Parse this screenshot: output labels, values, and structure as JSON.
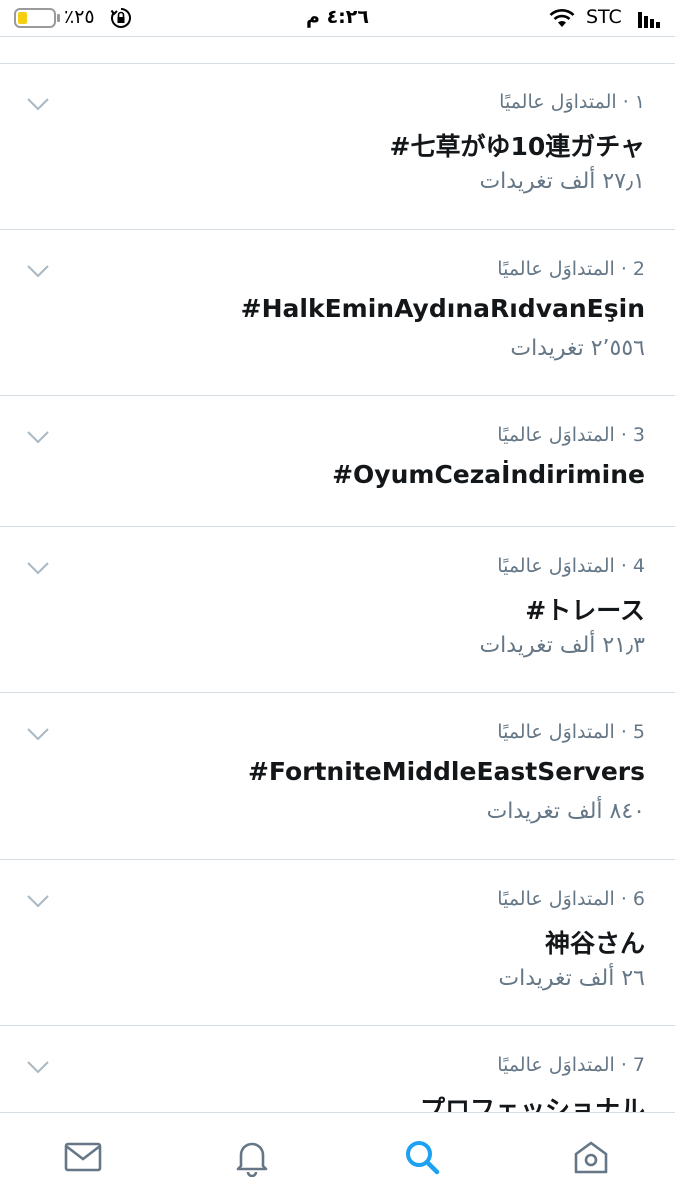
{
  "status_bar": {
    "battery_percent_text": "٪٢٥",
    "battery_level": 0.25,
    "battery_color": "#f6cf12",
    "time": "٤:٢٦ م",
    "carrier": "STC"
  },
  "trends": [
    {
      "meta": "١ · المتداوَل عالميًا",
      "name": "#七草がゆ10連ガチャ",
      "count": "٢٧٫١ ألف تغريدات"
    },
    {
      "meta": "2 · المتداوَل عالميًا",
      "name": "#HalkEminAydınaRıdvanEşin",
      "count": "٢٬٥٥٦ تغريدات"
    },
    {
      "meta": "3 · المتداوَل عالميًا",
      "name": "#OyumCezaİndirimine",
      "count": ""
    },
    {
      "meta": "4 · المتداوَل عالميًا",
      "name": "#トレース",
      "count": "٢١٫٣ ألف تغريدات"
    },
    {
      "meta": "5 · المتداوَل عالميًا",
      "name": "#FortniteMiddleEastServers",
      "count": "٨٤٠ ألف تغريدات"
    },
    {
      "meta": "6 · المتداوَل عالميًا",
      "name": "神谷さん",
      "count": "٢٦ ألف تغريدات"
    },
    {
      "meta": "7 · المتداوَل عالميًا",
      "name": "プロフェッショナル",
      "count": ""
    }
  ],
  "tab_bar": {
    "tabs": [
      {
        "icon": "home-icon",
        "active": false
      },
      {
        "icon": "search-icon",
        "active": true
      },
      {
        "icon": "notifications-icon",
        "active": false
      },
      {
        "icon": "messages-icon",
        "active": false
      }
    ],
    "active_color": "#1da1f2",
    "inactive_color": "#657786"
  }
}
